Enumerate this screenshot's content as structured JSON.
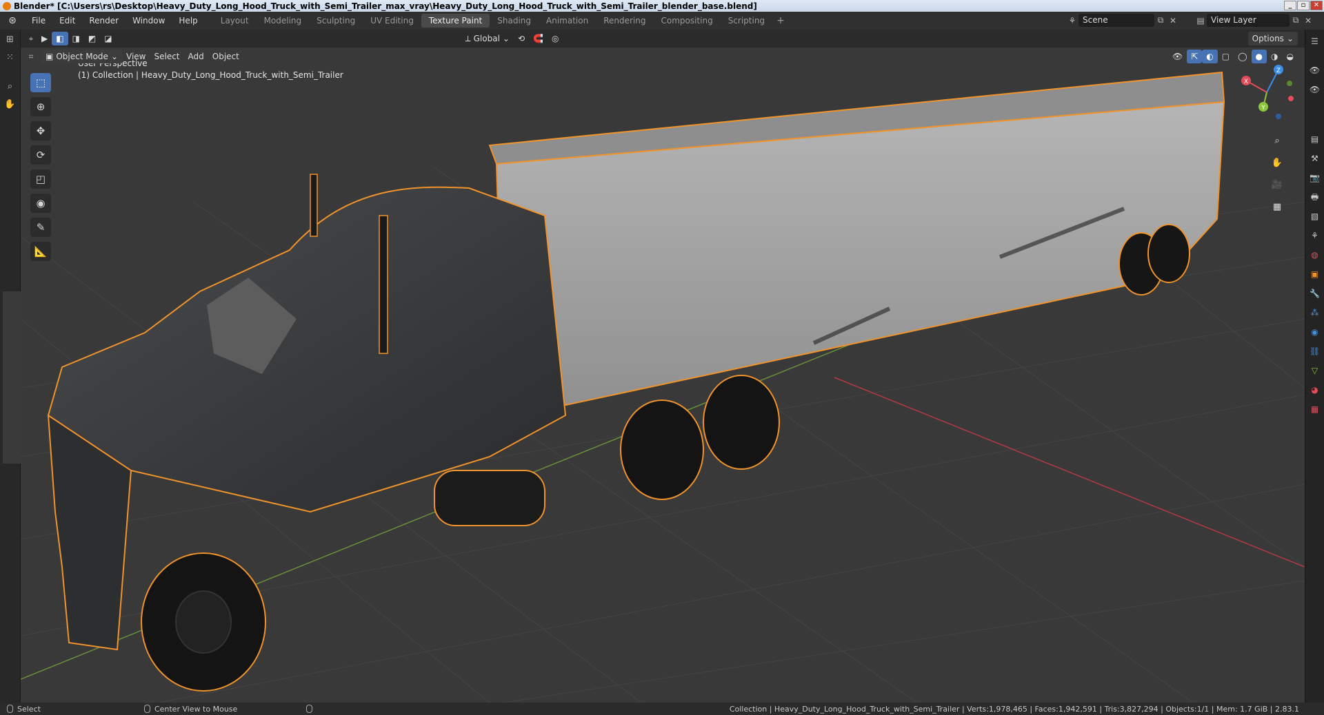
{
  "window": {
    "title": "Blender* [C:\\Users\\rs\\Desktop\\Heavy_Duty_Long_Hood_Truck_with_Semi_Trailer_max_vray\\Heavy_Duty_Long_Hood_Truck_with_Semi_Trailer_blender_base.blend]"
  },
  "menu": {
    "items": [
      "File",
      "Edit",
      "Render",
      "Window",
      "Help"
    ]
  },
  "workspaces": {
    "tabs": [
      "Layout",
      "Modeling",
      "Sculpting",
      "UV Editing",
      "Texture Paint",
      "Shading",
      "Animation",
      "Rendering",
      "Compositing",
      "Scripting"
    ],
    "active": "Texture Paint"
  },
  "scene": {
    "name": "Scene"
  },
  "view_layer": {
    "name": "View Layer"
  },
  "tool_header": {
    "orientation": "Global",
    "options": "Options"
  },
  "viewport_header": {
    "mode": "Object Mode",
    "menus": [
      "View",
      "Select",
      "Add",
      "Object"
    ]
  },
  "viewport": {
    "perspective": "User Perspective",
    "collection_info": "(1) Collection | Heavy_Duty_Long_Hood_Truck_with_Semi_Trailer",
    "gizmo_axes": [
      "X",
      "Y",
      "Z"
    ],
    "gizmo_colors": {
      "x": "#e44b5b",
      "y": "#8cc63f",
      "z": "#3b8ee8"
    },
    "selection_outline_color": "#f0932b"
  },
  "statusbar": {
    "left_action": "Select",
    "middle_action": "Center View to Mouse",
    "stats": "Collection | Heavy_Duty_Long_Hood_Truck_with_Semi_Trailer | Verts:1,978,465 | Faces:1,942,591 | Tris:3,827,294 | Objects:1/1 | Mem: 1.7 GiB | 2.83.1"
  },
  "icons": {
    "left_tools": [
      "select-box-icon",
      "cursor-icon",
      "move-icon",
      "rotate-icon",
      "scale-icon",
      "transform-icon",
      "annotate-icon",
      "measure-icon"
    ],
    "nav": [
      "zoom-icon",
      "hand-pan-icon",
      "camera-icon",
      "ortho-grid-icon"
    ]
  }
}
